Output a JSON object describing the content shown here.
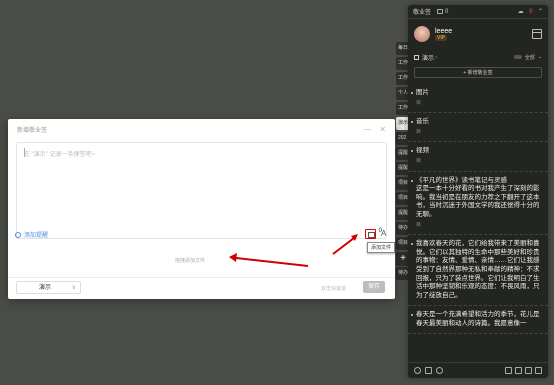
{
  "background_tabs": [
    "每日",
    "工作",
    "工作",
    "个人",
    "工作",
    "演示",
    "202",
    "提醒",
    "提醒",
    "项目",
    "项目",
    "提醒",
    "待办",
    "项目",
    "项目",
    "待办"
  ],
  "side_panel": {
    "app_title": "敬业签",
    "tab_count": "0",
    "user": {
      "name": "leeee",
      "badge": "VIP"
    },
    "list": {
      "name": "演示",
      "count": "7",
      "filter": "全部"
    },
    "new_button": "+ 新增敬业签",
    "notes": [
      {
        "text": "图片",
        "meta": "目"
      },
      {
        "text": "音乐",
        "meta": "目"
      },
      {
        "text": "视频",
        "meta": "目"
      },
      {
        "text": "《平凡的世界》读书笔记与灵感\n这是一本十分好看的书对我产生了深刻的影响。我当初是在朋友的力荐之下翻开了这本书，当时沉迷于外国文学的我还觉得十分的无聊。",
        "meta": "目"
      },
      {
        "text": "我喜欢春天的花，它们给我带来了美丽和喜悦。它们以其独特的生命中那些美好和珍贵的事物：友情、爱情、亲情……它们让我感受到了自然界那种无私和奉献的精神：不求回报，只为了装点世界。它们让我明白了生活中那种坚韧和乐观的态度：不畏风雨，只为了绽放自己。",
        "meta": ""
      },
      {
        "text": "春天是一个充满希望和活力的季节，花儿是春天最美丽和动人的诗篇。我愿意像一",
        "meta": ""
      }
    ]
  },
  "dialog": {
    "title": "新增敬业签",
    "placeholder": "在 \"演示\" 记录一条便签吧~",
    "word_count": "0",
    "add_reminder": "添加提醒",
    "click_to_add_file": "拖拽添加文件",
    "tooltip": "添加文件",
    "list_select": "演示",
    "footer_hint": "双击快速退",
    "save_label": "保存"
  },
  "colors": {
    "accent": "#4a8fe0",
    "annotation": "#d00000"
  }
}
